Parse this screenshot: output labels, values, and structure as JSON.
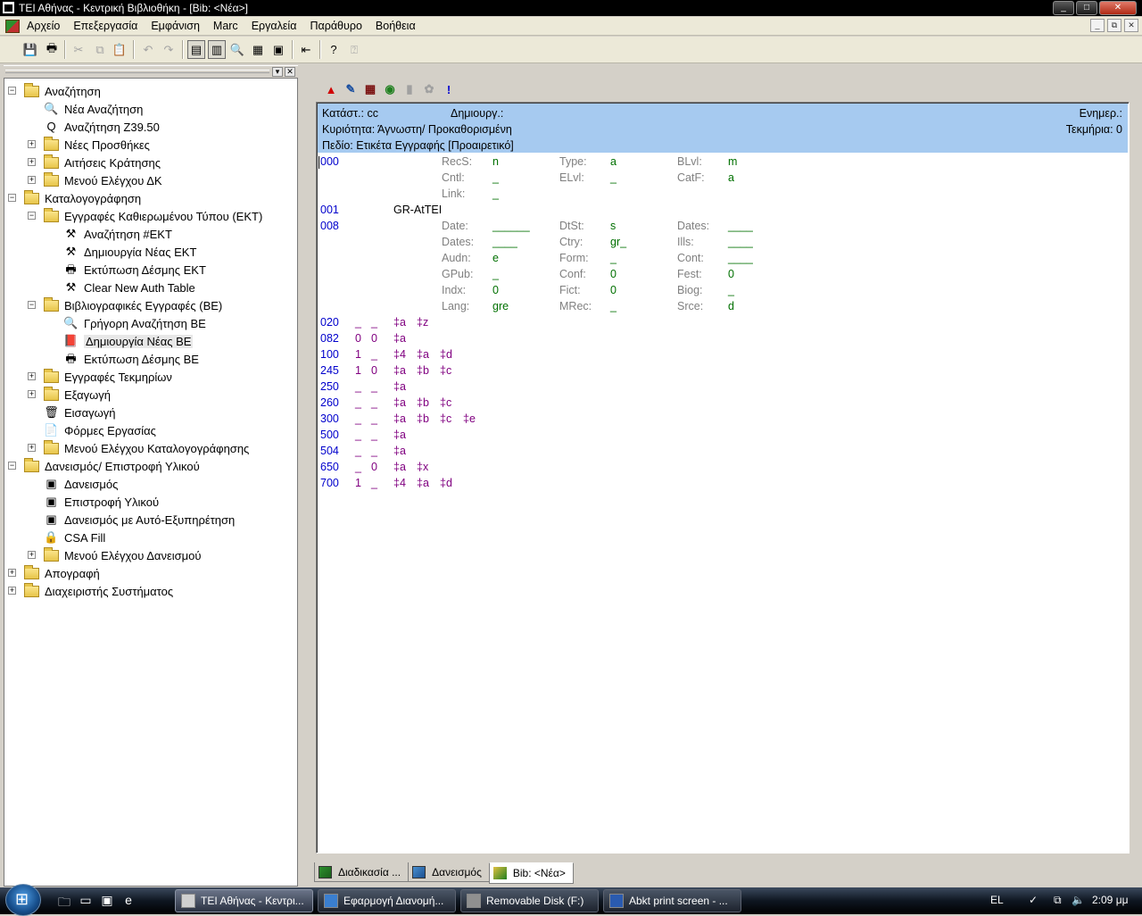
{
  "window": {
    "title": "ΤΕΙ Αθήνας - Κεντρική Βιβλιοθήκη - [Bib: <Νέα>]",
    "controls": [
      "_",
      "□",
      "✕"
    ]
  },
  "menu": [
    "Αρχείο",
    "Επεξεργασία",
    "Εμφάνιση",
    "Marc",
    "Εργαλεία",
    "Παράθυρο",
    "Βοήθεια"
  ],
  "mdi_controls": [
    "_",
    "⧉",
    "✕"
  ],
  "toolbar": [
    "save-icon",
    "print-icon",
    "cut-icon",
    "copy-icon",
    "paste-icon",
    "undo-icon",
    "redo-icon",
    "tile-window-icon",
    "split-window-icon",
    "search-tool-icon",
    "grid-icon",
    "form-icon",
    "exit-icon",
    "help-icon",
    "context-help-icon"
  ],
  "tree": [
    {
      "label": "Αναζήτηση",
      "level": 0,
      "type": "folder",
      "exp": "−"
    },
    {
      "label": "Νέα Αναζήτηση",
      "level": 1,
      "type": "item",
      "icon": "🔍"
    },
    {
      "label": "Αναζήτηση Z39.50",
      "level": 1,
      "type": "item",
      "icon": "Q"
    },
    {
      "label": "Νέες Προσθήκες",
      "level": 1,
      "type": "folder",
      "exp": "+"
    },
    {
      "label": "Αιτήσεις Κράτησης",
      "level": 1,
      "type": "folder",
      "exp": "+"
    },
    {
      "label": "Μενού Ελέγχου ΔΚ",
      "level": 1,
      "type": "folder",
      "exp": "+"
    },
    {
      "label": "Καταλογογράφηση",
      "level": 0,
      "type": "folder",
      "exp": "−"
    },
    {
      "label": "Εγγραφές Καθιερωμένου Τύπου (ΕΚΤ)",
      "level": 1,
      "type": "folder",
      "exp": "−"
    },
    {
      "label": "Αναζήτηση #ΕΚΤ",
      "level": 2,
      "type": "item",
      "icon": "⚒"
    },
    {
      "label": "Δημιουργία Νέας ΕΚΤ",
      "level": 2,
      "type": "item",
      "icon": "⚒"
    },
    {
      "label": "Εκτύπωση Δέσμης ΕΚΤ",
      "level": 2,
      "type": "item",
      "icon": "🖶"
    },
    {
      "label": "Clear New Auth Table",
      "level": 2,
      "type": "item",
      "icon": "⚒"
    },
    {
      "label": "Βιβλιογραφικές Εγγραφές (ΒΕ)",
      "level": 1,
      "type": "folder",
      "exp": "−"
    },
    {
      "label": "Γρήγορη Αναζήτηση ΒΕ",
      "level": 2,
      "type": "item",
      "icon": "🔍"
    },
    {
      "label": "Δημιουργία Νέας ΒΕ",
      "level": 2,
      "type": "item",
      "icon": "📕",
      "selected": true
    },
    {
      "label": "Εκτύπωση Δέσμης ΒΕ",
      "level": 2,
      "type": "item",
      "icon": "🖶"
    },
    {
      "label": "Εγγραφές Τεκμηρίων",
      "level": 1,
      "type": "folder",
      "exp": "+"
    },
    {
      "label": "Εξαγωγή",
      "level": 1,
      "type": "folder",
      "exp": "+"
    },
    {
      "label": "Εισαγωγή",
      "level": 1,
      "type": "item",
      "icon": "🗑"
    },
    {
      "label": "Φόρμες Εργασίας",
      "level": 1,
      "type": "item",
      "icon": "📄"
    },
    {
      "label": "Μενού Ελέγχου Καταλογογράφησης",
      "level": 1,
      "type": "folder",
      "exp": "+"
    },
    {
      "label": "Δανεισμός/ Επιστροφή Υλικού",
      "level": 0,
      "type": "folder",
      "exp": "−"
    },
    {
      "label": "Δανεισμός",
      "level": 1,
      "type": "item",
      "icon": "▣"
    },
    {
      "label": "Επιστροφή Υλικού",
      "level": 1,
      "type": "item",
      "icon": "▣"
    },
    {
      "label": "Δανεισμός με Αυτό-Εξυπηρέτηση",
      "level": 1,
      "type": "item",
      "icon": "▣"
    },
    {
      "label": "CSA Fill",
      "level": 1,
      "type": "item",
      "icon": "🔒"
    },
    {
      "label": "Μενού Ελέγχου Δανεισμού",
      "level": 1,
      "type": "folder",
      "exp": "+"
    },
    {
      "label": "Απογραφή",
      "level": 0,
      "type": "folder",
      "exp": "+"
    },
    {
      "label": "Διαχειριστής Συστήματος",
      "level": 0,
      "type": "folder",
      "exp": "+"
    }
  ],
  "record_toolbar": [
    {
      "icon": "▲",
      "color": "#d00000"
    },
    {
      "icon": "✎",
      "color": "#1a4fa0"
    },
    {
      "icon": "▦",
      "color": "#7a1010"
    },
    {
      "icon": "◉",
      "color": "#208020"
    },
    {
      "icon": "▮",
      "color": "#a0a0a0"
    },
    {
      "icon": "✿",
      "color": "#a0a0a0"
    },
    {
      "icon": "!",
      "color": "#0000d0"
    }
  ],
  "info": {
    "status": "Κατάστ.: cc",
    "created": "Δημιουργ.:",
    "updated": "Ενημερ.:",
    "owner": "Κυριότητα: Άγνωστη/ Προκαθορισμένη",
    "items": "Τεκμήρια: 0",
    "field": "Πεδίο: Ετικέτα Εγγραφής [Προαιρετικό]"
  },
  "fixed_fields": {
    "tag000": "000",
    "tag001": "001",
    "val001": "GR-AtTEI",
    "tag008": "008",
    "f000": [
      {
        "label": "RecS:",
        "value": "n"
      },
      {
        "label": "Type:",
        "value": "a"
      },
      {
        "label": "BLvl:",
        "value": "m"
      },
      {
        "label": "Cntl:",
        "value": "_"
      },
      {
        "label": "ELvl:",
        "value": "_"
      },
      {
        "label": "CatF:",
        "value": "a"
      },
      {
        "label": "Link:",
        "value": "_"
      }
    ],
    "f008": [
      {
        "label": "Date:",
        "value": "______"
      },
      {
        "label": "DtSt:",
        "value": "s"
      },
      {
        "label": "Dates:",
        "value": "____"
      },
      {
        "label": "Dates:",
        "value": "____"
      },
      {
        "label": "Ctry:",
        "value": "gr_"
      },
      {
        "label": "Ills:",
        "value": "____"
      },
      {
        "label": "Audn:",
        "value": "e"
      },
      {
        "label": "Form:",
        "value": "_"
      },
      {
        "label": "Cont:",
        "value": "____"
      },
      {
        "label": "GPub:",
        "value": "_"
      },
      {
        "label": "Conf:",
        "value": "0"
      },
      {
        "label": "Fest:",
        "value": "0"
      },
      {
        "label": "Indx:",
        "value": "0"
      },
      {
        "label": "Fict:",
        "value": "0"
      },
      {
        "label": "Biog:",
        "value": "_"
      },
      {
        "label": "Lang:",
        "value": "gre"
      },
      {
        "label": "MRec:",
        "value": "_"
      },
      {
        "label": "Srce:",
        "value": "d"
      }
    ]
  },
  "fields": [
    {
      "tag": "020",
      "i1": "_",
      "i2": "_",
      "subs": [
        "‡a",
        "‡z"
      ]
    },
    {
      "tag": "082",
      "i1": "0",
      "i2": "0",
      "subs": [
        "‡a"
      ]
    },
    {
      "tag": "100",
      "i1": "1",
      "i2": "_",
      "subs": [
        "‡4",
        "‡a",
        "‡d"
      ]
    },
    {
      "tag": "245",
      "i1": "1",
      "i2": "0",
      "subs": [
        "‡a",
        "‡b",
        "‡c"
      ]
    },
    {
      "tag": "250",
      "i1": "_",
      "i2": "_",
      "subs": [
        "‡a"
      ]
    },
    {
      "tag": "260",
      "i1": "_",
      "i2": "_",
      "subs": [
        "‡a",
        "‡b",
        "‡c"
      ]
    },
    {
      "tag": "300",
      "i1": "_",
      "i2": "_",
      "subs": [
        "‡a",
        "‡b",
        "‡c",
        "‡e"
      ]
    },
    {
      "tag": "500",
      "i1": "_",
      "i2": "_",
      "subs": [
        "‡a"
      ]
    },
    {
      "tag": "504",
      "i1": "_",
      "i2": "_",
      "subs": [
        "‡a"
      ]
    },
    {
      "tag": "650",
      "i1": "_",
      "i2": "0",
      "subs": [
        "‡a",
        "‡x"
      ]
    },
    {
      "tag": "700",
      "i1": "1",
      "i2": "_",
      "subs": [
        "‡4",
        "‡a",
        "‡d"
      ]
    }
  ],
  "tabs": [
    "Διαδικασία ...",
    "Δανεισμός",
    "Bib: <Νέα>"
  ],
  "taskbar": {
    "tasks": [
      "ΤΕΙ Αθήνας - Κεντρι...",
      "Εφαρμογή Διανομή...",
      "Removable Disk (F:)",
      "Abkt print screen - ..."
    ],
    "lang": "EL",
    "clock": "2:09 μμ"
  }
}
